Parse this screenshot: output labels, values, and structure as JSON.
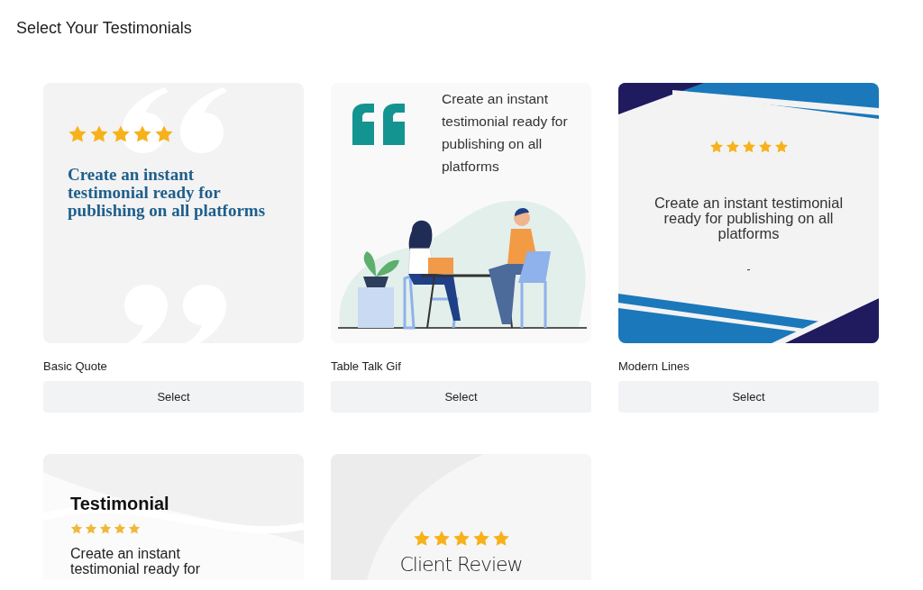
{
  "page": {
    "title": "Select Your Testimonials"
  },
  "templates": [
    {
      "kind": "basic-quote",
      "name": "Basic Quote",
      "button": "Select",
      "preview": {
        "stars": 5,
        "text": "Create an instant testimonial ready for publishing on all platforms"
      }
    },
    {
      "kind": "table-talk",
      "name": "Table Talk Gif",
      "button": "Select",
      "preview": {
        "text": "Create an instant testimonial ready for publishing on all platforms"
      }
    },
    {
      "kind": "modern-lines",
      "name": "Modern Lines",
      "button": "Select",
      "preview": {
        "stars": 5,
        "text": "Create an instant testimonial ready for publishing on all platforms",
        "footer": "-"
      }
    },
    {
      "kind": "wave",
      "preview": {
        "heading": "Testimonial",
        "stars": 5,
        "text": "Create an instant testimonial ready for"
      }
    },
    {
      "kind": "client-review",
      "preview": {
        "stars": 5,
        "heading": "Client Review"
      }
    }
  ]
}
